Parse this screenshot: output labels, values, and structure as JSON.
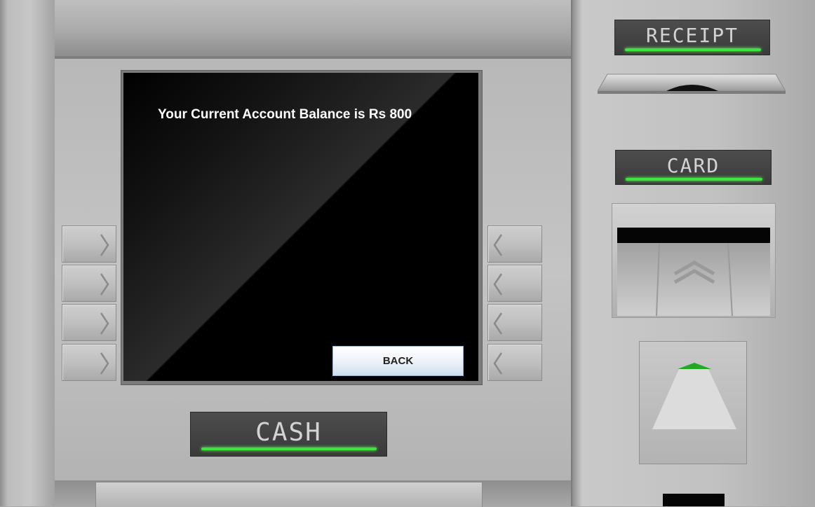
{
  "screen": {
    "balance_message": "Your Current Account Balance is Rs 800",
    "back_button_label": "BACK"
  },
  "labels": {
    "receipt": "RECEIPT",
    "card": "CARD",
    "cash": "CASH"
  },
  "side_keys": {
    "left_icon": "chevron-right-icon",
    "right_icon": "chevron-left-icon"
  },
  "colors": {
    "indicator_green": "#3ee43e",
    "screen_background": "#000000",
    "label_text": "#d3d3d3"
  }
}
